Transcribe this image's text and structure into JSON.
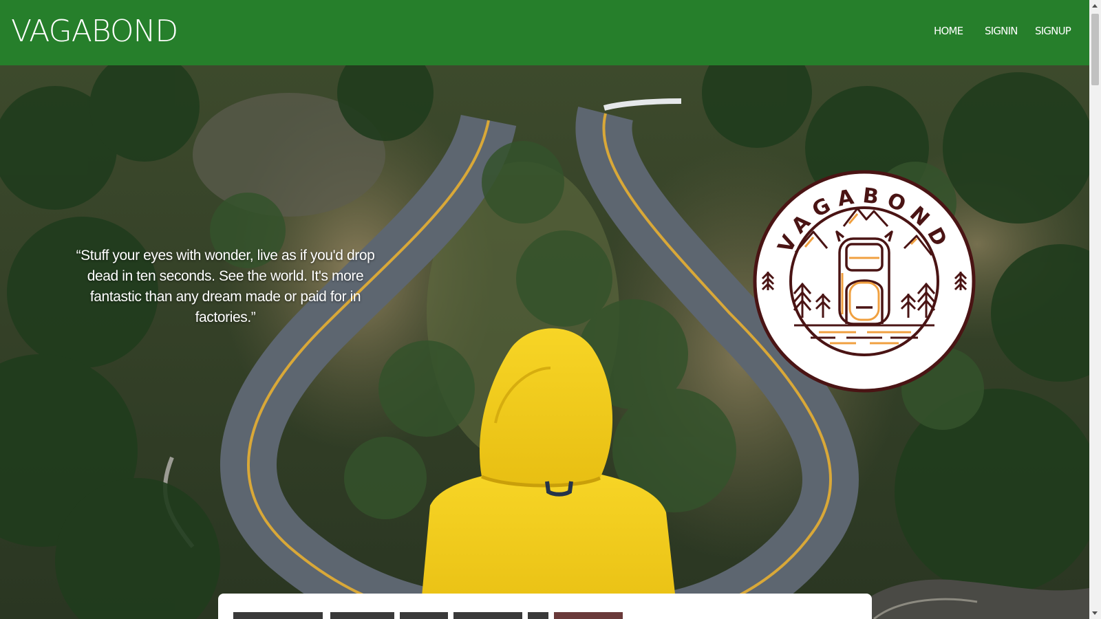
{
  "header": {
    "brand": "VAGABOND",
    "nav": [
      {
        "label": "HOME"
      },
      {
        "label": "SIGNIN"
      },
      {
        "label": "SIGNUP"
      }
    ]
  },
  "hero": {
    "quote": "“Stuff your eyes with wonder, live as if you'd drop dead in ten seconds. See the world. It's more fantastic than any dream made or paid for in factories.”",
    "background_image": "winding-road-forest-hooded-person-photo",
    "badge": {
      "text": "VAGABOND",
      "icon": "backpack-mountains-trees-icon"
    }
  },
  "colors": {
    "navbar": "#267f2b",
    "nav_text": "#ffffff",
    "badge_ring": "#4a1414",
    "badge_accent": "#f0a040",
    "raincoat": "#f5cf1c"
  }
}
